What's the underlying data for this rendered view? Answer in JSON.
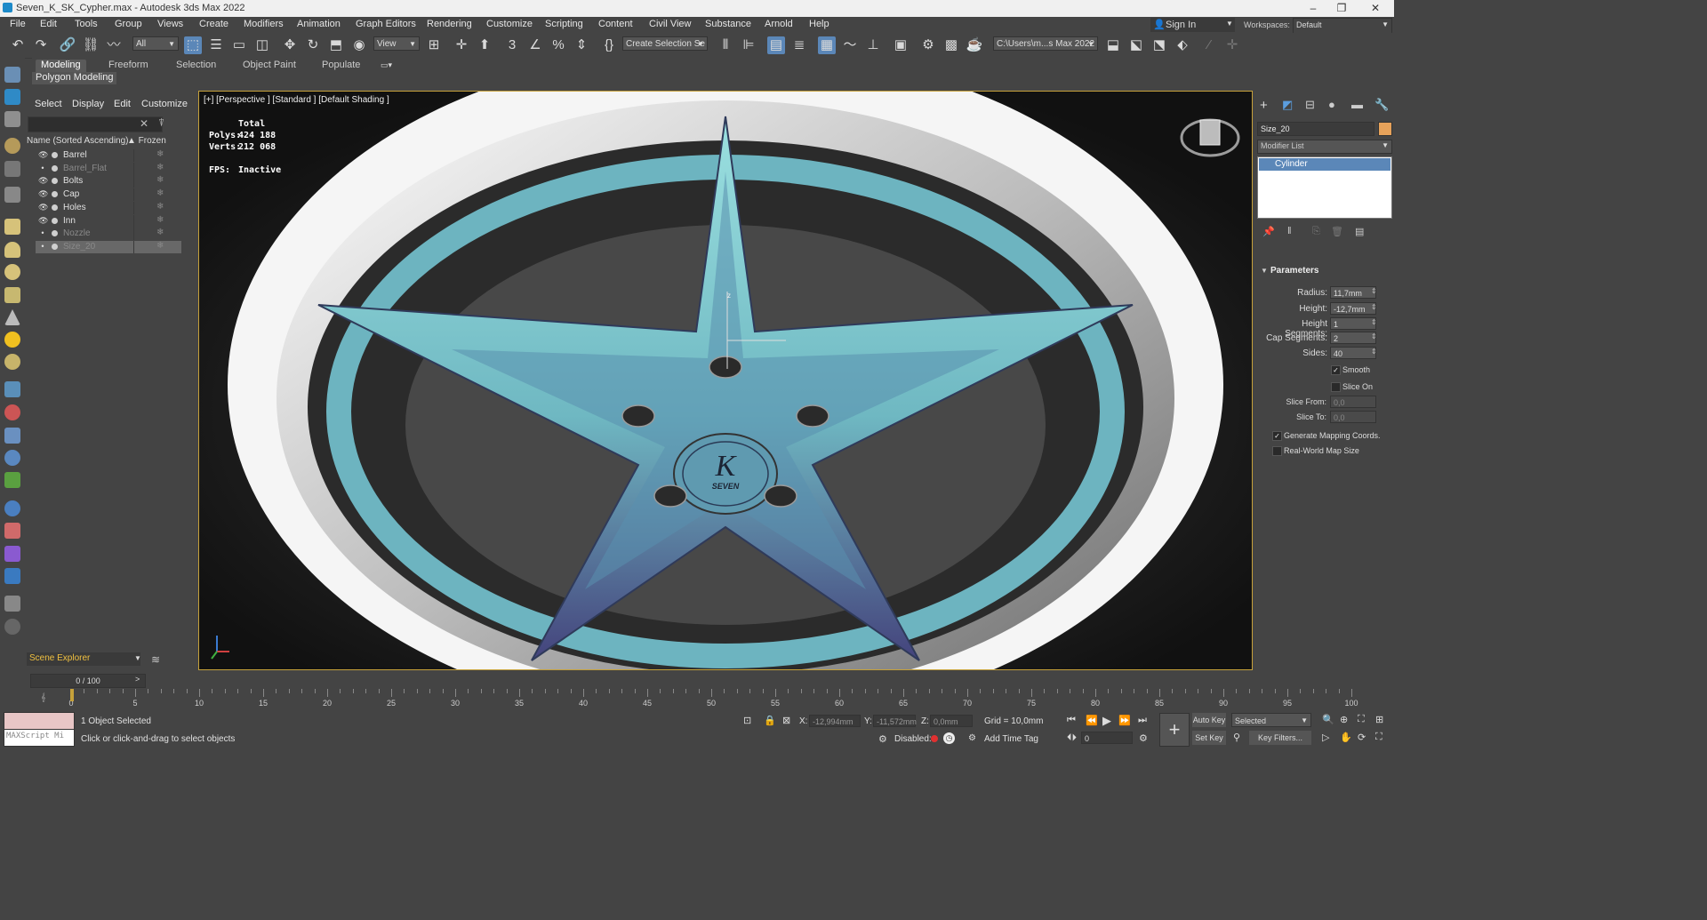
{
  "window": {
    "title": "Seven_K_SK_Cypher.max - Autodesk 3ds Max 2022",
    "minimize": "–",
    "maximize": "❐",
    "close": "✕"
  },
  "menu": [
    "File",
    "Edit",
    "Tools",
    "Group",
    "Views",
    "Create",
    "Modifiers",
    "Animation",
    "Graph Editors",
    "Rendering",
    "Customize",
    "Scripting",
    "Content",
    "Civil View",
    "Substance",
    "Arnold",
    "Help"
  ],
  "account": {
    "sign_in": "Sign In",
    "workspaces_label": "Workspaces:",
    "workspace": "Default"
  },
  "toolbar": {
    "filter": "All",
    "ref_coord": "View",
    "selection_set": "Create Selection Se",
    "project_path": "C:\\Users\\m...s Max 2022"
  },
  "ribbon": {
    "tabs": [
      "Modeling",
      "Freeform",
      "Selection",
      "Object Paint",
      "Populate"
    ],
    "panel": "Polygon Modeling"
  },
  "explorer": {
    "menu": [
      "Select",
      "Display",
      "Edit",
      "Customize"
    ],
    "col_name": "Name (Sorted Ascending)",
    "col_frozen": "▲ Frozen",
    "rows": [
      {
        "name": "Barrel",
        "visible": true
      },
      {
        "name": "Barrel_Flat",
        "visible": false
      },
      {
        "name": "Bolts",
        "visible": true
      },
      {
        "name": "Cap",
        "visible": true
      },
      {
        "name": "Holes",
        "visible": true
      },
      {
        "name": "Inn",
        "visible": true
      },
      {
        "name": "Nozzle",
        "visible": false
      },
      {
        "name": "Size_20",
        "visible": false,
        "selected": true
      }
    ],
    "footer": "Scene Explorer"
  },
  "viewport": {
    "label": "[+] [Perspective ] [Standard ] [Default Shading ]",
    "stats": {
      "total_label": "Total",
      "polys_label": "Polys:",
      "polys": "424 188",
      "verts_label": "Verts:",
      "verts": "212 068",
      "fps_label": "FPS:",
      "fps": "Inactive"
    },
    "gizmo_z": "z",
    "logo_text": "SEVEN"
  },
  "command_panel": {
    "object_name": "Size_20",
    "modifier_list": "Modifier List",
    "stack": [
      "Cylinder"
    ],
    "rollout": "Parameters",
    "params": [
      {
        "label": "Radius:",
        "value": "11,7mm"
      },
      {
        "label": "Height:",
        "value": "-12,7mm"
      },
      {
        "label": "Height Segments:",
        "value": "1"
      },
      {
        "label": "Cap Segments:",
        "value": "2"
      },
      {
        "label": "Sides:",
        "value": "40"
      }
    ],
    "smooth": "Smooth",
    "slice_on": "Slice On",
    "slice_from_label": "Slice From:",
    "slice_from": "0,0",
    "slice_to_label": "Slice To:",
    "slice_to": "0,0",
    "gen_mapping": "Generate Mapping Coords.",
    "real_world": "Real-World Map Size"
  },
  "timeline": {
    "slider": "0 / 100",
    "ticks": [
      0,
      5,
      10,
      15,
      20,
      25,
      30,
      35,
      40,
      45,
      50,
      55,
      60,
      65,
      70,
      75,
      80,
      85,
      90,
      95,
      100
    ]
  },
  "status": {
    "maxscript": "MAXScript Mi",
    "selected": "1 Object Selected",
    "prompt": "Click or click-and-drag to select objects",
    "x_label": "X:",
    "x": "-12,994mm",
    "y_label": "Y:",
    "y": "-11,572mm",
    "z_label": "Z:",
    "z": "0,0mm",
    "grid": "Grid = 10,0mm",
    "disabled": "Disabled:",
    "add_time_tag": "Add Time Tag",
    "auto_key": "Auto Key",
    "key_mode": "Selected",
    "set_key": "Set Key",
    "key_filters": "Key Filters...",
    "frame": "0"
  },
  "colors": {
    "accent": "#5b87b8",
    "viewport_border": "#c6a13a",
    "wheel_face": "#7ec6c8",
    "wheel_shadow": "#3f3a6e",
    "object_color": "#e6a25a"
  }
}
